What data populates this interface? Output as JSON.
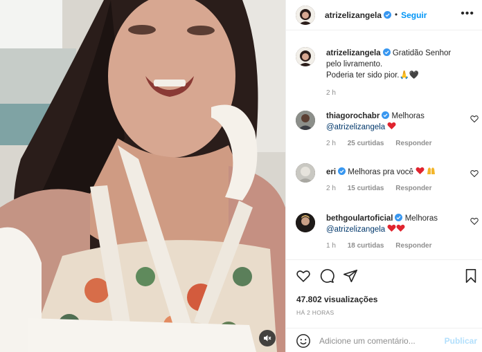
{
  "post": {
    "author": "atrizelizangela",
    "follow_label": "Seguir",
    "more_label": "•••",
    "caption": {
      "username": "atrizelizangela",
      "text_line1": "Gratidão Senhor pelo livramento.",
      "text_line2": "Poderia ter sido pior.",
      "emoji": "🙏🖤",
      "age": "2 h"
    },
    "views": "47.802 visualizações",
    "posted": "HÁ 2 HORAS"
  },
  "comments": [
    {
      "username": "thiagorochabr",
      "text": "Melhoras",
      "mention": "@atrizelizangela",
      "age": "2 h",
      "likes": "25 curtidas",
      "reply": "Responder"
    },
    {
      "username": "eri",
      "text": "Melhoras pra você",
      "age": "2 h",
      "likes": "15 curtidas",
      "reply": "Responder"
    },
    {
      "username": "bethgoulartoficial",
      "text": "Melhoras",
      "mention": "@atrizelizangela",
      "age": "1 h",
      "likes": "18 curtidas",
      "reply": "Responder"
    }
  ],
  "composer": {
    "placeholder": "Adicione um comentário...",
    "publish_label": "Publicar"
  },
  "colors": {
    "accent": "#0095f6",
    "heart": "#ed4956",
    "verified": "#3897f0"
  }
}
